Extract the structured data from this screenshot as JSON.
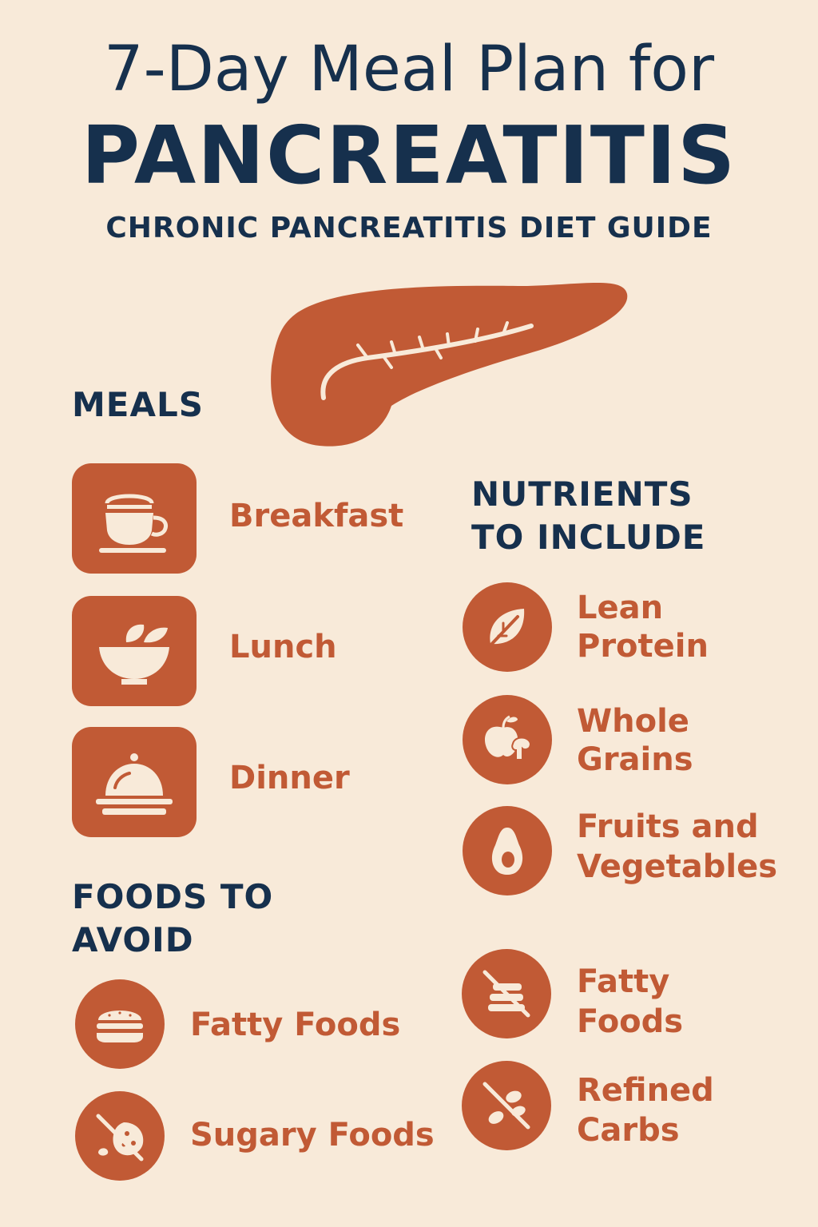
{
  "header": {
    "title_line1": "7-Day Meal Plan for",
    "title_line2": "PANCREATITIS",
    "subtitle": "CHRONIC PANCREATITIS DIET GUIDE"
  },
  "meals": {
    "heading": "MEALS",
    "items": [
      {
        "label": "Breakfast",
        "icon": "cup-icon"
      },
      {
        "label": "Lunch",
        "icon": "salad-bowl-icon"
      },
      {
        "label": "Dinner",
        "icon": "cloche-icon"
      }
    ]
  },
  "nutrients": {
    "heading_line1": "NUTRIENTS",
    "heading_line2": "TO INCLUDE",
    "items": [
      {
        "line1": "Lean",
        "line2": "Protein",
        "icon": "leaf-icon"
      },
      {
        "line1": "Whole",
        "line2": "Grains",
        "icon": "fruit-icon"
      },
      {
        "line1": "Fruits and",
        "line2": "Vegetables",
        "icon": "avocado-icon"
      },
      {
        "line1": "Fatty",
        "line2": "Foods",
        "icon": "no-pancakes-icon"
      },
      {
        "line1": "Refined",
        "line2": "Carbs",
        "icon": "no-bread-icon"
      }
    ]
  },
  "avoid": {
    "heading_line1": "FOODS TO",
    "heading_line2": "AVOID",
    "items": [
      {
        "label": "Fatty Foods",
        "icon": "burger-icon"
      },
      {
        "label": "Sugary Foods",
        "icon": "no-cookie-icon"
      }
    ]
  },
  "colors": {
    "background": "#f8ead9",
    "navy": "#16304d",
    "accent": "#c15a35",
    "icon_fill": "#f8ead9"
  }
}
